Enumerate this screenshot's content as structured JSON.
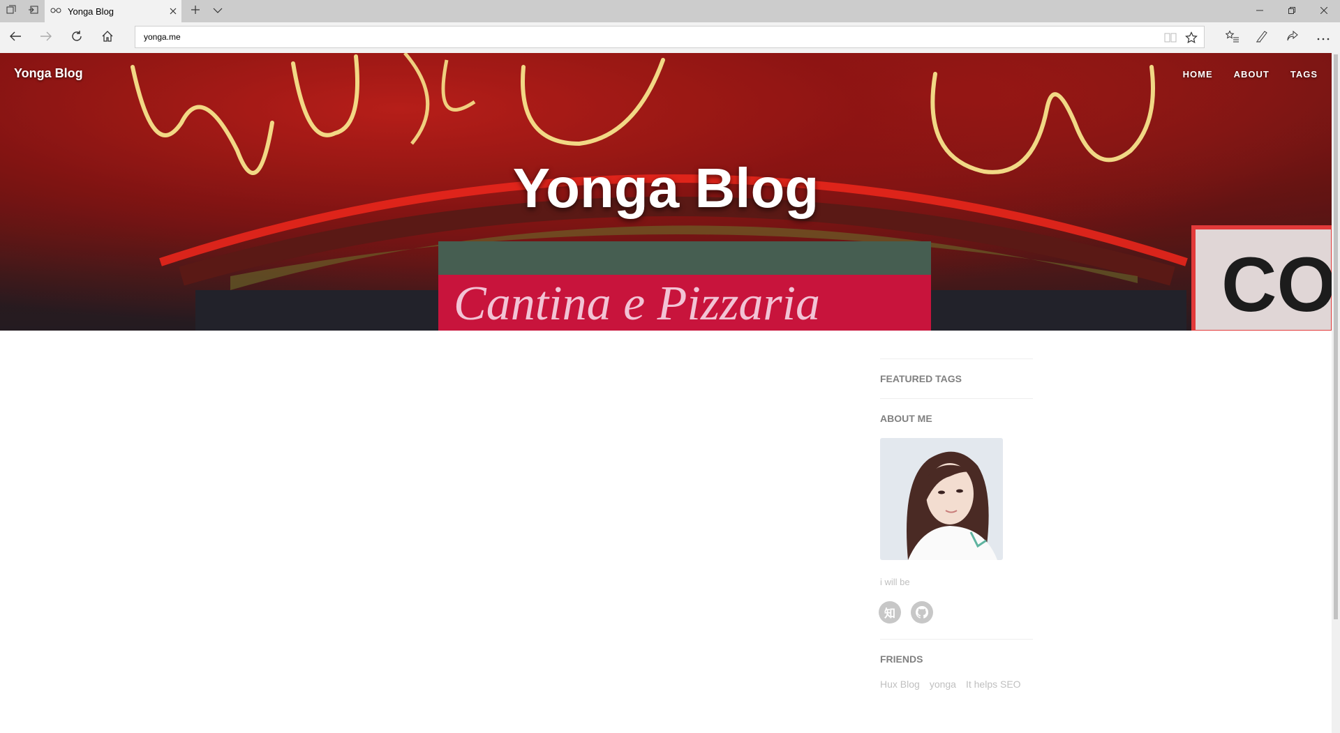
{
  "browser": {
    "tab_title": "Yonga Blog",
    "url": "yonga.me"
  },
  "site": {
    "brand": "Yonga Blog",
    "nav": [
      "HOME",
      "ABOUT",
      "TAGS"
    ],
    "hero_title": "Yonga Blog",
    "hero_image_text": "Cantina e Pizzaria"
  },
  "sidebar": {
    "featured_tags_heading": "FEATURED TAGS",
    "about_heading": "ABOUT ME",
    "motto": "i will be",
    "social": [
      {
        "label": "知",
        "icon": "zhihu-icon"
      },
      {
        "label": "",
        "icon": "github-icon"
      }
    ],
    "friends_heading": "FRIENDS",
    "friends": [
      "Hux Blog",
      "yonga",
      "It helps SEO"
    ]
  }
}
